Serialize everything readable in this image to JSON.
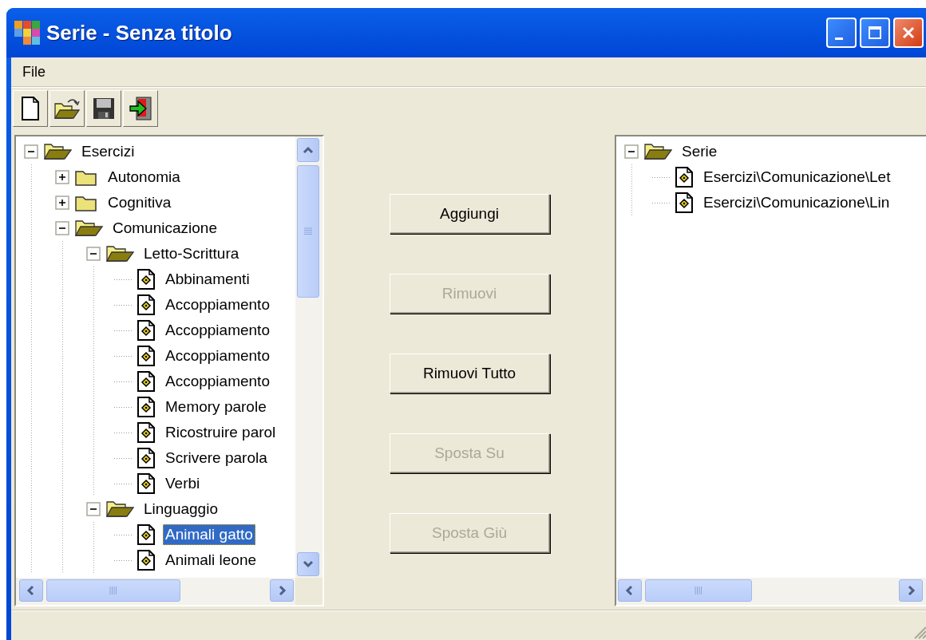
{
  "window": {
    "title": "Serie - Senza titolo"
  },
  "menu": [
    {
      "label": "File"
    }
  ],
  "exercise_tree": {
    "items": [
      {
        "label": "Esercizi",
        "kind": "folder",
        "expanded": true,
        "selected": false,
        "children": [
          {
            "label": "Autonomia",
            "kind": "folder",
            "expanded": false,
            "selected": false
          },
          {
            "label": "Cognitiva",
            "kind": "folder",
            "expanded": false,
            "selected": false
          },
          {
            "label": "Comunicazione",
            "kind": "folder",
            "expanded": true,
            "selected": false,
            "children": [
              {
                "label": "Letto-Scrittura",
                "kind": "folder",
                "expanded": true,
                "selected": false,
                "children": [
                  {
                    "label": "Abbinamenti",
                    "kind": "file",
                    "selected": false
                  },
                  {
                    "label": "Accoppiamento",
                    "kind": "file",
                    "selected": false
                  },
                  {
                    "label": "Accoppiamento",
                    "kind": "file",
                    "selected": false
                  },
                  {
                    "label": "Accoppiamento",
                    "kind": "file",
                    "selected": false
                  },
                  {
                    "label": "Accoppiamento",
                    "kind": "file",
                    "selected": false
                  },
                  {
                    "label": "Memory parole",
                    "kind": "file",
                    "selected": false
                  },
                  {
                    "label": "Ricostruire parol",
                    "kind": "file",
                    "selected": false
                  },
                  {
                    "label": "Scrivere parola",
                    "kind": "file",
                    "selected": false
                  },
                  {
                    "label": "Verbi",
                    "kind": "file",
                    "selected": false
                  }
                ]
              },
              {
                "label": "Linguaggio",
                "kind": "folder",
                "expanded": true,
                "selected": false,
                "children": [
                  {
                    "label": "Animali gatto",
                    "kind": "file",
                    "selected": true
                  },
                  {
                    "label": "Animali leone",
                    "kind": "file",
                    "selected": false
                  }
                ]
              }
            ]
          }
        ]
      }
    ]
  },
  "action_buttons": [
    {
      "label": "Aggiungi",
      "disabled": false
    },
    {
      "label": "Rimuovi",
      "disabled": true
    },
    {
      "label": "Rimuovi Tutto",
      "disabled": false
    },
    {
      "label": "Sposta Su",
      "disabled": true
    },
    {
      "label": "Sposta Giù",
      "disabled": true
    }
  ],
  "series_tree": {
    "items": [
      {
        "label": "Serie",
        "kind": "folder",
        "expanded": true,
        "selected": false,
        "children": [
          {
            "label": "Esercizi\\Comunicazione\\Let",
            "kind": "file",
            "selected": false
          },
          {
            "label": "Esercizi\\Comunicazione\\Lin",
            "kind": "file",
            "selected": false
          }
        ]
      }
    ]
  }
}
